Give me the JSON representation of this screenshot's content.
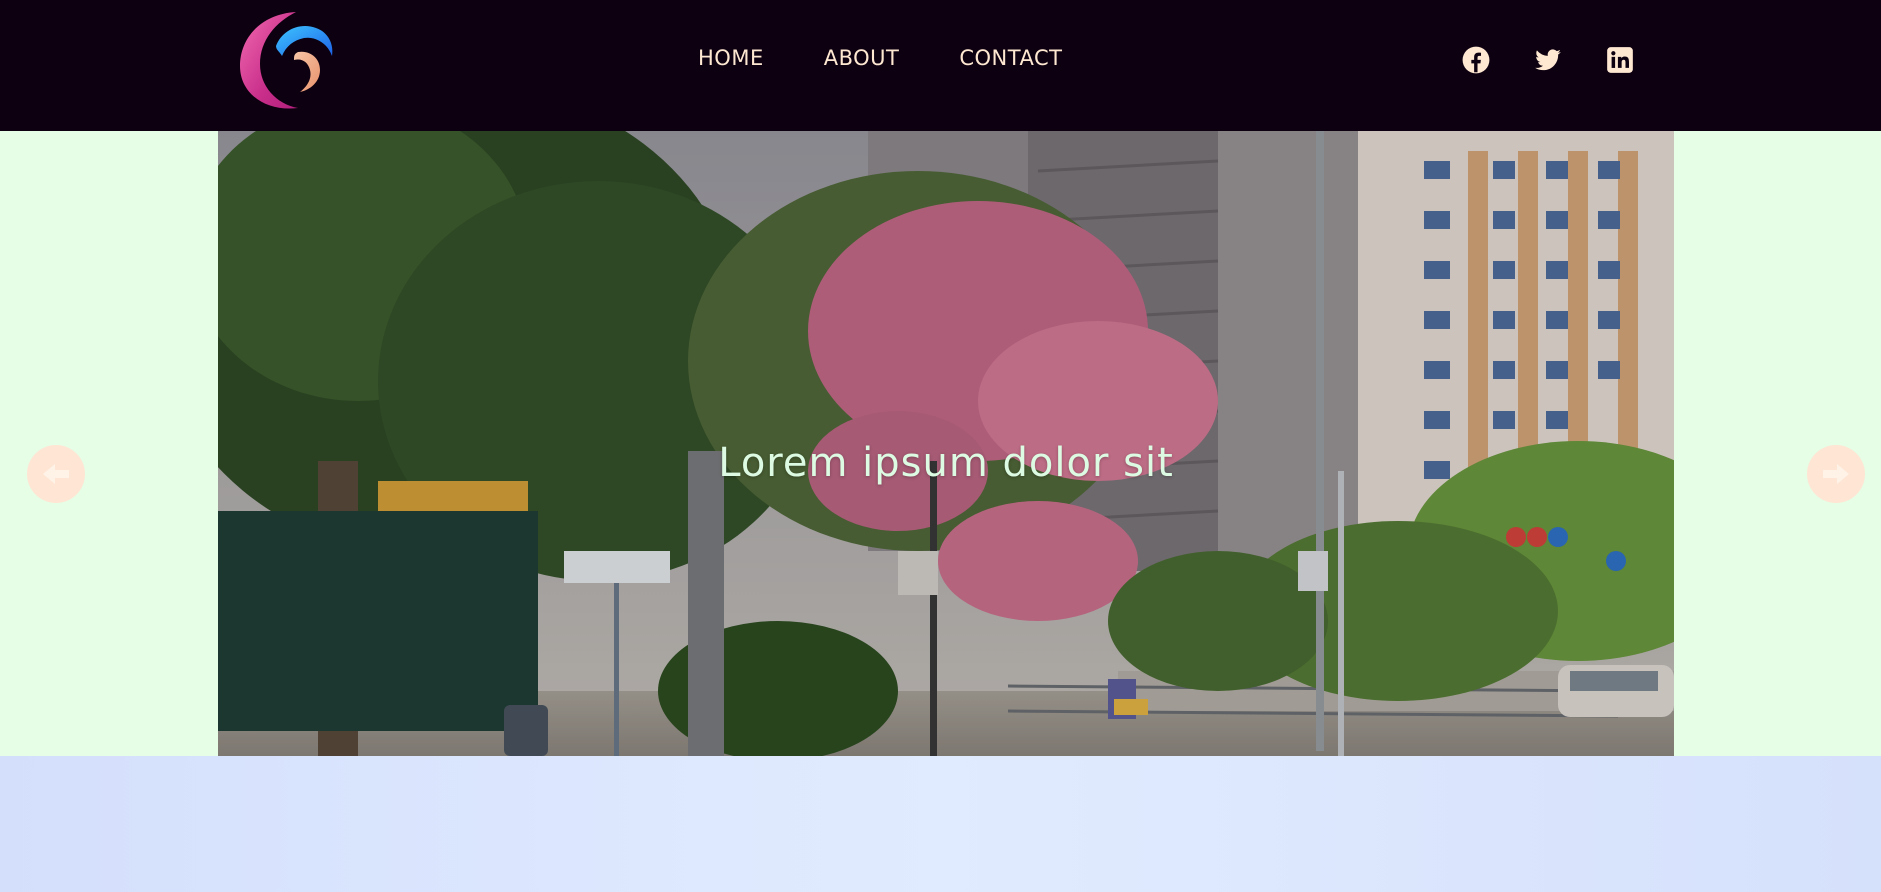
{
  "header": {
    "logo_icon": "crescent-swirl-logo",
    "nav": [
      {
        "label": "HOME"
      },
      {
        "label": "ABOUT"
      },
      {
        "label": "CONTACT"
      }
    ],
    "social": [
      {
        "icon": "facebook-icon"
      },
      {
        "icon": "twitter-icon"
      },
      {
        "icon": "linkedin-icon"
      }
    ]
  },
  "hero": {
    "caption": "Lorem ipsum dolor sit",
    "prev_icon": "arrow-left-icon",
    "next_icon": "arrow-right-icon"
  },
  "colors": {
    "header_bg": "#0d0010",
    "nav_text": "#ffe8d2",
    "page_bg": "#e6fde6",
    "arrow_bg": "#ffe6d4",
    "lower_bg": "#dbe5fd"
  }
}
